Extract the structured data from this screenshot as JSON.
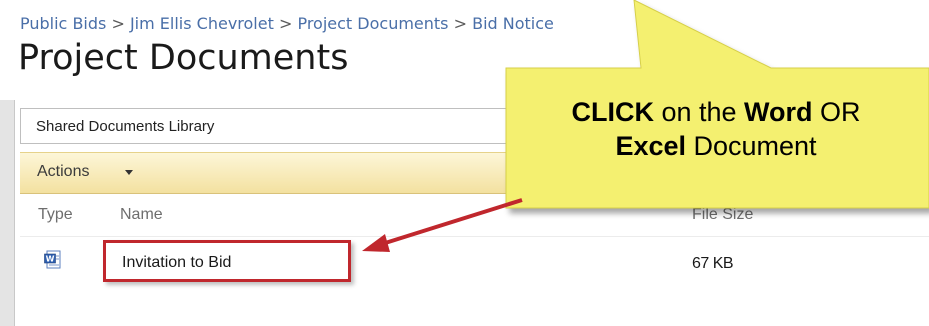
{
  "breadcrumb": {
    "items": [
      "Public Bids",
      "Jim Ellis Chevrolet",
      "Project Documents",
      "Bid Notice"
    ],
    "separator": ">"
  },
  "page": {
    "title": "Project Documents"
  },
  "library": {
    "title": "Shared Documents Library",
    "actions_label": "Actions"
  },
  "table": {
    "columns": [
      "Type",
      "Name",
      "File Size"
    ],
    "rows": [
      {
        "type_icon": "word-document-icon",
        "name": "Invitation to Bid",
        "file_size": "67 KB"
      }
    ]
  },
  "callout": {
    "line1_bold": "CLICK",
    "line1_mid": " on the ",
    "line1_bold2": "Word",
    "line1_end": " OR",
    "line2_bold": "Excel",
    "line2_end": " Document",
    "fill_color": "#f4f070",
    "arrow_color": "#c0272d"
  }
}
